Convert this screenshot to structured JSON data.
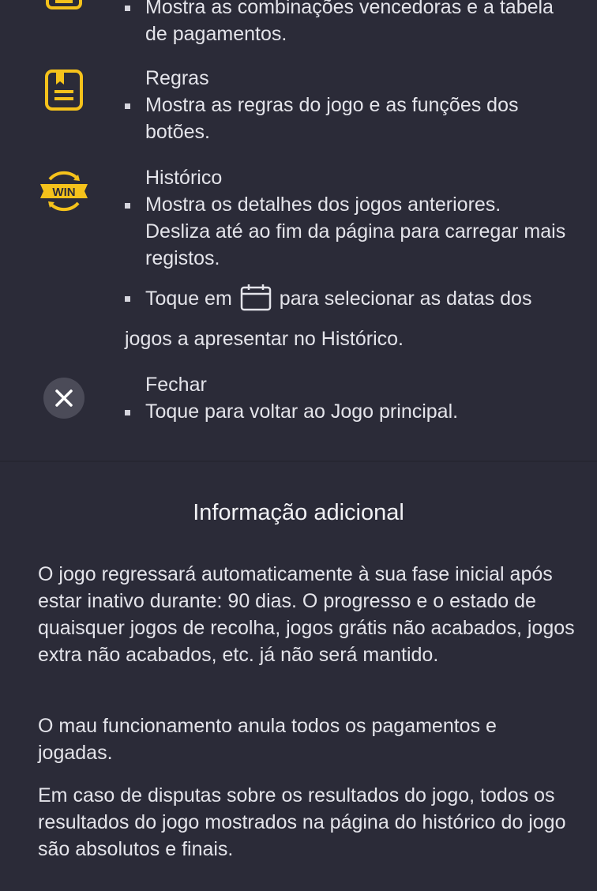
{
  "items": [
    {
      "icon": "paytable-icon",
      "title": "",
      "bullets": [
        "Mostra as combinações vencedoras e a tabela de pagamentos."
      ]
    },
    {
      "icon": "rules-icon",
      "title": "Regras",
      "bullets": [
        "Mostra as regras do jogo e as funções dos botões."
      ]
    },
    {
      "icon": "win-history-icon",
      "title": "Histórico",
      "bullets": [
        "Mostra os detalhes dos jogos anteriores. Desliza até ao fim da página para carregar mais registos.",
        "Toque em",
        "para selecionar as datas dos",
        "jogos a apresentar no Histórico."
      ],
      "icon_label": "WIN"
    },
    {
      "icon": "close-icon",
      "title": "Fechar",
      "bullets": [
        "Toque para voltar ao Jogo principal."
      ]
    }
  ],
  "additional": {
    "title": "Informação adicional",
    "paragraphs": [
      "O jogo regressará automaticamente à sua fase inicial após estar inativo durante: 90 dias. O progresso e o estado de quaisquer jogos de recolha, jogos grátis não acabados, jogos extra não acabados, etc. já não será mantido.",
      "O mau funcionamento anula todos os pagamentos e jogadas.",
      "Em caso de disputas sobre os resultados do jogo, todos os resultados do jogo mostrados na página do histórico do jogo são absolutos e finais."
    ]
  },
  "colors": {
    "background": "#2b2b38",
    "accent_yellow": "#f5c21b",
    "text": "#e4e4ea",
    "close_circle": "#4b4b58"
  }
}
